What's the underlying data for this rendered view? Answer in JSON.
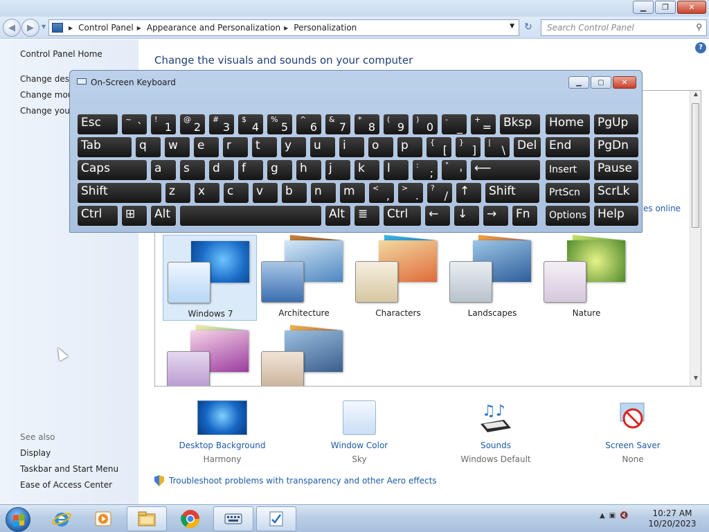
{
  "window": {
    "caption": {
      "minimize": "▁",
      "maximize": "❐",
      "close": "✕"
    }
  },
  "address": {
    "breadcrumbs": [
      "Control Panel",
      "Appearance and Personalization",
      "Personalization"
    ],
    "search_placeholder": "Search Control Panel"
  },
  "left_pane": {
    "home": "Control Panel Home",
    "links": [
      "Change deskt",
      "Change mous",
      "Change your"
    ],
    "see_also": "See also",
    "see_also_links": [
      "Display",
      "Taskbar and Start Menu",
      "Ease of Access Center"
    ]
  },
  "main": {
    "heading": "Change the visuals and sounds on your computer",
    "online_link": "es online",
    "themes": [
      {
        "label": "Windows 7",
        "selected": true
      },
      {
        "label": "Architecture",
        "selected": false
      },
      {
        "label": "Characters",
        "selected": false
      },
      {
        "label": "Landscapes",
        "selected": false
      },
      {
        "label": "Nature",
        "selected": false
      },
      {
        "label": "",
        "selected": false
      },
      {
        "label": "",
        "selected": false
      }
    ],
    "bottom_items": [
      {
        "title": "Desktop Background",
        "subtitle": "Harmony",
        "icon": "desktop-background-icon"
      },
      {
        "title": "Window Color",
        "subtitle": "Sky",
        "icon": "window-color-icon"
      },
      {
        "title": "Sounds",
        "subtitle": "Windows Default",
        "icon": "sounds-icon"
      },
      {
        "title": "Screen Saver",
        "subtitle": "None",
        "icon": "screen-saver-icon"
      }
    ],
    "troubleshoot": "Troubleshoot problems with transparency and other Aero effects"
  },
  "osk": {
    "title": "On-Screen Keyboard",
    "rows": [
      [
        {
          "m": "Esc"
        },
        {
          "s": "~",
          "b": "`"
        },
        {
          "s": "!",
          "b": "1"
        },
        {
          "s": "@",
          "b": "2"
        },
        {
          "s": "#",
          "b": "3"
        },
        {
          "s": "$",
          "b": "4"
        },
        {
          "s": "%",
          "b": "5"
        },
        {
          "s": "^",
          "b": "6"
        },
        {
          "s": "&",
          "b": "7"
        },
        {
          "s": "*",
          "b": "8"
        },
        {
          "s": "(",
          "b": "9"
        },
        {
          "s": ")",
          "b": "0"
        },
        {
          "s": "-",
          "b": "_"
        },
        {
          "s": "+",
          "b": "="
        },
        {
          "m": "Bksp"
        },
        {
          "m": "Home"
        },
        {
          "m": "PgUp"
        }
      ],
      [
        {
          "m": "Tab"
        },
        {
          "m": "q"
        },
        {
          "m": "w"
        },
        {
          "m": "e"
        },
        {
          "m": "r"
        },
        {
          "m": "t"
        },
        {
          "m": "y"
        },
        {
          "m": "u"
        },
        {
          "m": "i"
        },
        {
          "m": "o"
        },
        {
          "m": "p"
        },
        {
          "s": "{",
          "b": "["
        },
        {
          "s": "}",
          "b": "]"
        },
        {
          "s": "|",
          "b": "\\"
        },
        {
          "m": "Del"
        },
        {
          "m": "End"
        },
        {
          "m": "PgDn"
        }
      ],
      [
        {
          "m": "Caps"
        },
        {
          "m": "a"
        },
        {
          "m": "s"
        },
        {
          "m": "d"
        },
        {
          "m": "f"
        },
        {
          "m": "g"
        },
        {
          "m": "h"
        },
        {
          "m": "j"
        },
        {
          "m": "k"
        },
        {
          "m": "l"
        },
        {
          "s": ":",
          "b": ";"
        },
        {
          "s": "\"",
          "b": "'"
        },
        {
          "m": "⟵"
        },
        {
          "m": "Insert"
        },
        {
          "m": "Pause"
        }
      ],
      [
        {
          "m": "Shift"
        },
        {
          "m": "z"
        },
        {
          "m": "x"
        },
        {
          "m": "c"
        },
        {
          "m": "v"
        },
        {
          "m": "b"
        },
        {
          "m": "n"
        },
        {
          "m": "m"
        },
        {
          "s": "<",
          "b": ","
        },
        {
          "s": ">",
          "b": "."
        },
        {
          "s": "?",
          "b": "/"
        },
        {
          "m": "↑"
        },
        {
          "m": "Shift"
        },
        {
          "m": "PrtScn"
        },
        {
          "m": "ScrLk"
        }
      ],
      [
        {
          "m": "Ctrl"
        },
        {
          "m": "⊞"
        },
        {
          "m": "Alt"
        },
        {
          "m": ""
        },
        {
          "m": "Alt"
        },
        {
          "m": "≣"
        },
        {
          "m": "Ctrl"
        },
        {
          "m": "←"
        },
        {
          "m": "↓"
        },
        {
          "m": "→"
        },
        {
          "m": "Fn"
        },
        {
          "m": "Options"
        },
        {
          "m": "Help"
        }
      ]
    ]
  },
  "taskbar": {
    "apps": [
      "internet-explorer-icon",
      "media-player-icon",
      "explorer-icon",
      "chrome-icon",
      "on-screen-keyboard-icon",
      "control-panel-icon"
    ],
    "time": "10:27 AM",
    "date": "10/20/2023"
  },
  "colors": {
    "link": "#1e5aa8",
    "heading": "#1e3f77",
    "selected": "#dbeaf9"
  }
}
